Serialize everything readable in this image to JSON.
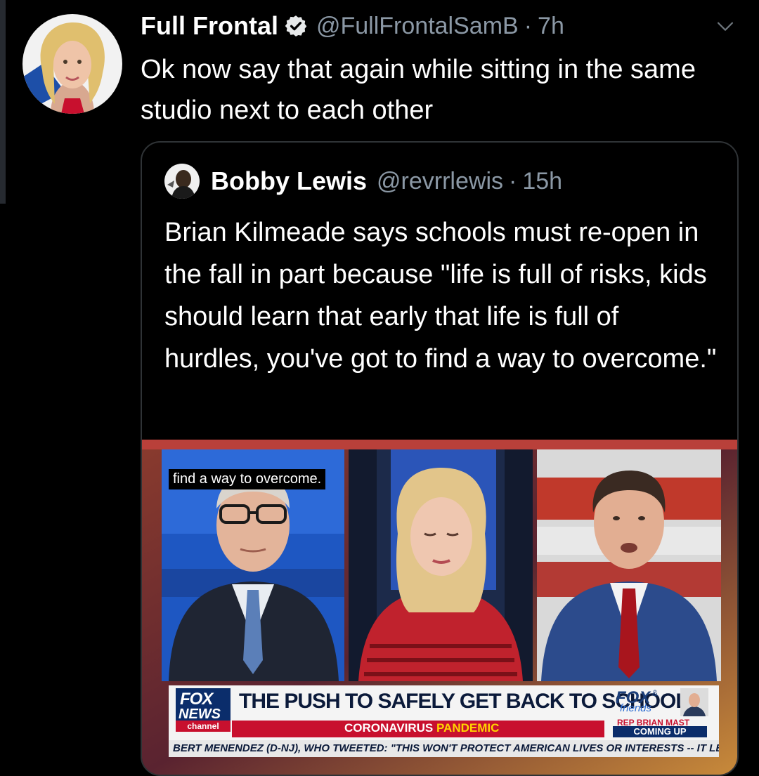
{
  "tweet": {
    "author_name": "Full Frontal",
    "verified_icon": "verified-badge-icon",
    "handle": "@FullFrontalSamB",
    "separator": "·",
    "time": "7h",
    "text": "Ok now say that again while sitting in the same studio next to each other",
    "menu_icon": "chevron-down-icon"
  },
  "quote": {
    "author_name": "Bobby Lewis",
    "handle": "@revrrlewis",
    "separator": "·",
    "time": "15h",
    "text": "Brian Kilmeade says schools must re-open in the fall in part because \"life is full of risks, kids should learn that early that life is full of hurdles, you've got to find a way to overcome.\""
  },
  "video": {
    "caption": "find a way to overcome.",
    "network_line1": "FOX",
    "network_line2": "NEWS",
    "network_line3": "channel",
    "headline": "THE PUSH TO SAFELY GET BACK TO SCHOOL",
    "subhead_main": "CORONAVIRUS ",
    "subhead_accent": "PANDEMIC",
    "show_logo": "FOX",
    "show_logo_amp": "&",
    "show_logo_sub": "friends",
    "promo_name": "REP BRIAN MAST",
    "promo_status": "COMING UP",
    "ticker": "BERT MENENDEZ (D-NJ), WHO TWEETED: \"THIS WON'T PROTECT AMERICAN LIVES OR INTERESTS -- IT LEAVE"
  },
  "colors": {
    "background": "#000000",
    "secondary_text": "#8b98a5",
    "verified_blue": "#1d9bf0",
    "card_border": "#2f3336",
    "fox_navy": "#0b2d6b",
    "fox_red": "#c8102e"
  }
}
